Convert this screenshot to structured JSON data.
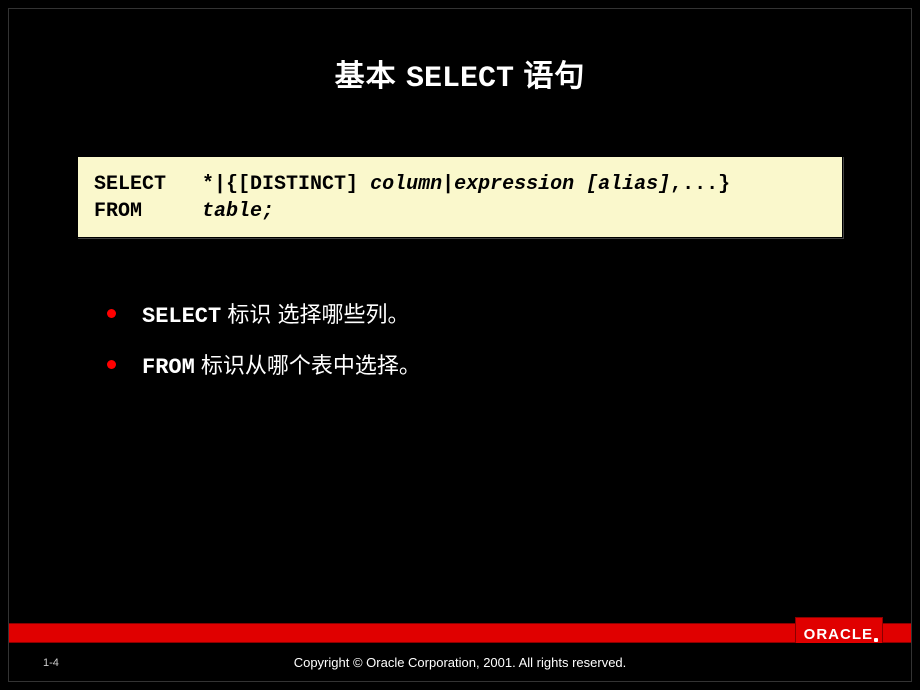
{
  "title": {
    "pre": "基本 ",
    "kw": "SELECT",
    "post": " 语句"
  },
  "code": {
    "l1_kw": "SELECT",
    "l1_sp": "   ",
    "l1_a": "*|{[DISTINCT] ",
    "l1_it": "column|expression [alias]",
    "l1_b": ",...}",
    "l2_kw": "FROM",
    "l2_sp": "     ",
    "l2_it": "table;"
  },
  "bullets": [
    {
      "kw": "SELECT",
      "post": " 标识 选择哪些列。"
    },
    {
      "kw": "FROM",
      "post": " 标识从哪个表中选择。"
    }
  ],
  "footer": {
    "page": "1-4",
    "copyright": "Copyright © Oracle Corporation, 2001. All rights reserved.",
    "brand": "ORACLE"
  }
}
